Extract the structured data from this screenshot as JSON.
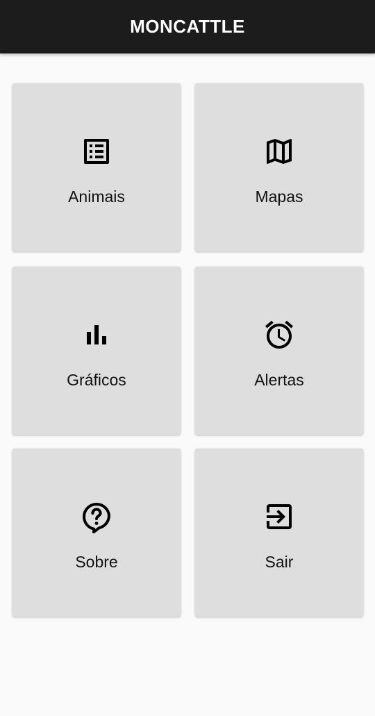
{
  "app_bar": {
    "title": "MONCATTLE"
  },
  "menu": [
    {
      "label": "Animais",
      "icon": "list-alt-icon"
    },
    {
      "label": "Mapas",
      "icon": "map-icon"
    },
    {
      "label": "Gráficos",
      "icon": "bar-chart-icon"
    },
    {
      "label": "Alertas",
      "icon": "alarm-clock-icon"
    },
    {
      "label": "Sobre",
      "icon": "help-question-icon"
    },
    {
      "label": "Sair",
      "icon": "exit-icon"
    }
  ],
  "colors": {
    "app_bar_bg": "#1c1c1c",
    "tile_bg": "#dedede",
    "page_bg": "#fafafa"
  }
}
